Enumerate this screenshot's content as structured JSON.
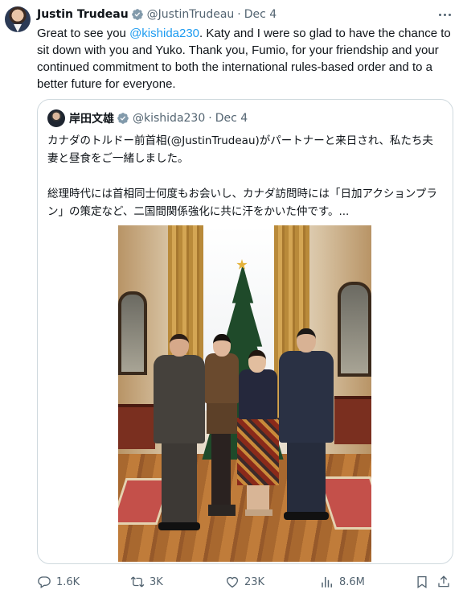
{
  "tweet": {
    "author_name": "Justin Trudeau",
    "handle": "@JustinTrudeau",
    "separator": "·",
    "date": "Dec 4",
    "text_before": "Great to see you ",
    "mention": "@kishida230",
    "text_after": ". Katy and I were so glad to have the chance to sit down with you and Yuko. Thank you, Fumio, for your friendship and your continued commitment to both the international rules-based order and to a better future for everyone."
  },
  "quote": {
    "author_name": "岸田文雄",
    "handle": "@kishida230",
    "separator": "·",
    "date": "Dec 4",
    "paragraph1": "カナダのトルドー前首相(@JustinTrudeau)がパートナーと来日され、私たち夫妻と昼食をご一緒しました。",
    "paragraph2": "総理時代には首相同士何度もお会いし、カナダ訪問時には「日加アクションプラン」の策定など、二国間関係強化に共に汗をかいた仲です。..."
  },
  "actions": {
    "replies": "1.6K",
    "retweets": "3K",
    "likes": "23K",
    "views": "8.6M"
  },
  "icons": {
    "verified": "verified-badge-icon",
    "more": "more-icon",
    "reply": "reply-icon",
    "retweet": "retweet-icon",
    "like": "heart-icon",
    "views": "views-icon",
    "bookmark": "bookmark-icon",
    "share": "share-icon"
  },
  "colors": {
    "accent": "#1d9bf0",
    "secondary_text": "#536471",
    "border": "#cfd9de"
  }
}
